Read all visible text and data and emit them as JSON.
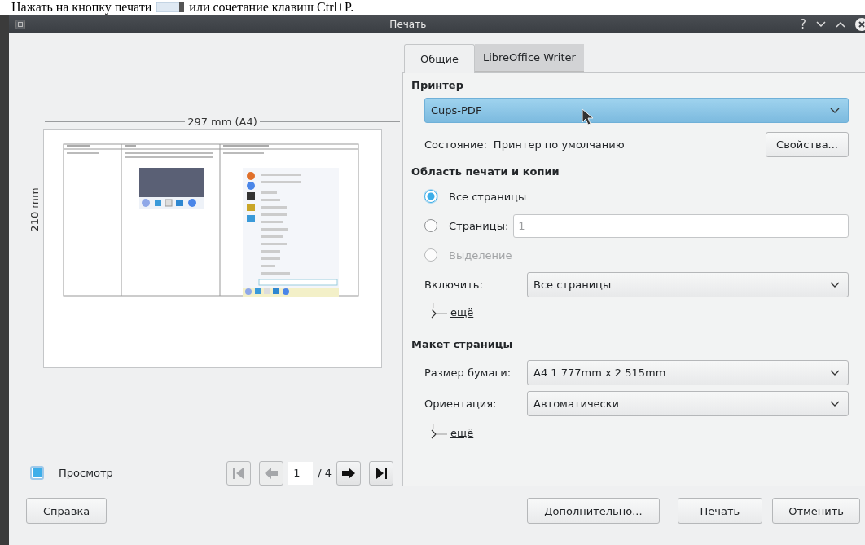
{
  "document_text": {
    "before": "Нажать на кнопку печати",
    "after": "или сочетание клавиш Ctrl+P."
  },
  "window": {
    "title": "Печать",
    "help": "?"
  },
  "preview": {
    "width_label": "297 mm (A4)",
    "height_label": "210 mm",
    "show_preview": {
      "label": "Просмотр",
      "checked": true
    },
    "page": "1",
    "page_count": "/ 4",
    "nav": [
      {
        "kind": "first",
        "disabled": true
      },
      {
        "kind": "prev",
        "disabled": true
      },
      {
        "kind": "next",
        "disabled": false
      },
      {
        "kind": "last",
        "disabled": false
      }
    ]
  },
  "tabs": [
    {
      "label": "Общие",
      "selected": true
    },
    {
      "label": "LibreOffice Writer",
      "selected": false
    }
  ],
  "printer": {
    "heading": "Принтер",
    "value": "Cups-PDF",
    "highlighted": true,
    "status_label": "Состояние:",
    "status": "Принтер по умолчанию",
    "properties_button": "Свойства..."
  },
  "range": {
    "heading": "Область печати и копии",
    "options": [
      {
        "label": "Все страницы",
        "selected": true,
        "disabled": false,
        "kind": "plain"
      },
      {
        "label": "Страницы:",
        "selected": false,
        "disabled": false,
        "kind": "pages",
        "placeholder": "1"
      },
      {
        "label": "Выделение",
        "selected": false,
        "disabled": true,
        "kind": "plain"
      }
    ],
    "include_label": "Включить:",
    "include_value": "Все страницы",
    "more": "ещё"
  },
  "layout": {
    "heading": "Макет страницы",
    "fields": [
      {
        "label": "Размер бумаги:",
        "value": "A4 1 777mm x 2 515mm"
      },
      {
        "label": "Ориентация:",
        "value": "Автоматически"
      }
    ],
    "more": "ещё"
  },
  "help_button": "Справка",
  "buttons": [
    "Дополнительно...",
    "Печать",
    "Отменить"
  ]
}
